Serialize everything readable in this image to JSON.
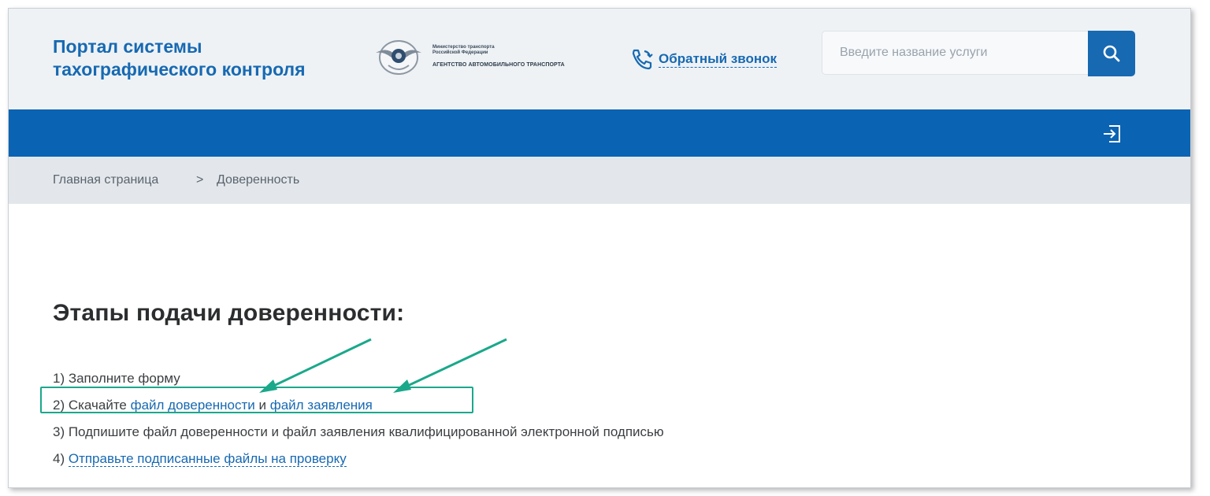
{
  "header": {
    "portal_title_line1": "Портал системы",
    "portal_title_line2": "тахографического контроля",
    "logo": {
      "ministry_line1": "Министерство транспорта",
      "ministry_line2": "Российской Федерации",
      "agency": "АГЕНТСТВО АВТОМОБИЛЬНОГО ТРАНСПОРТА"
    },
    "callback_label": "Обратный звонок",
    "search_placeholder": "Введите название услуги"
  },
  "breadcrumb": {
    "home": "Главная страница",
    "separator": ">",
    "current": "Доверенность"
  },
  "content": {
    "title": "Этапы подачи доверенности:",
    "steps": {
      "step1": "1) Заполните форму",
      "step2_prefix": "2) Скачайте ",
      "step2_link1": "файл доверенности",
      "step2_middle": " и ",
      "step2_link2": "файл заявления",
      "step3": "3) Подпишите файл доверенности и файл заявления квалифицированной электронной подписью",
      "step4_prefix": "4) ",
      "step4_link": "Отправьте подписанные файлы на проверку"
    }
  },
  "colors": {
    "brand_blue": "#1769b2",
    "navbar_blue": "#0a63b3",
    "header_bg": "#eef2f5",
    "breadcrumb_bg": "#e3e7eb",
    "annotation_green": "#1aa88a"
  },
  "icons": [
    "emblem-icon",
    "phone-callback-icon",
    "search-icon",
    "login-icon",
    "arrow-annotation-icon"
  ]
}
